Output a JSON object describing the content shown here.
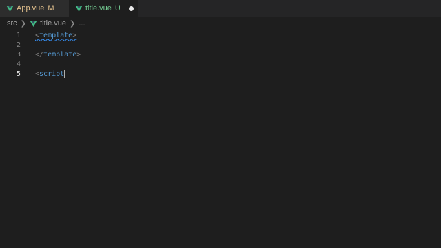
{
  "tabs": [
    {
      "name": "App.vue",
      "status": "M",
      "icon": "vue-icon"
    },
    {
      "name": "title.vue",
      "status": "U",
      "icon": "vue-icon",
      "modified_indicator": "unsaved-dot"
    }
  ],
  "breadcrumb": {
    "folder": "src",
    "file": "title.vue",
    "symbol": "..."
  },
  "editor": {
    "lines": [
      {
        "number": "1",
        "open": "<",
        "tag": "template",
        "close": ">"
      },
      {
        "number": "2"
      },
      {
        "number": "3",
        "open": "</",
        "tag": "template",
        "close": ">"
      },
      {
        "number": "4"
      },
      {
        "number": "5",
        "open": "<",
        "tag": "script",
        "close": ""
      }
    ],
    "current_line": "5"
  },
  "colors": {
    "background": "#1e1e1e",
    "tab_modified": "#e2c08d",
    "tab_untracked": "#73c991",
    "tag": "#569cd6",
    "squiggle": "#3794ff"
  }
}
